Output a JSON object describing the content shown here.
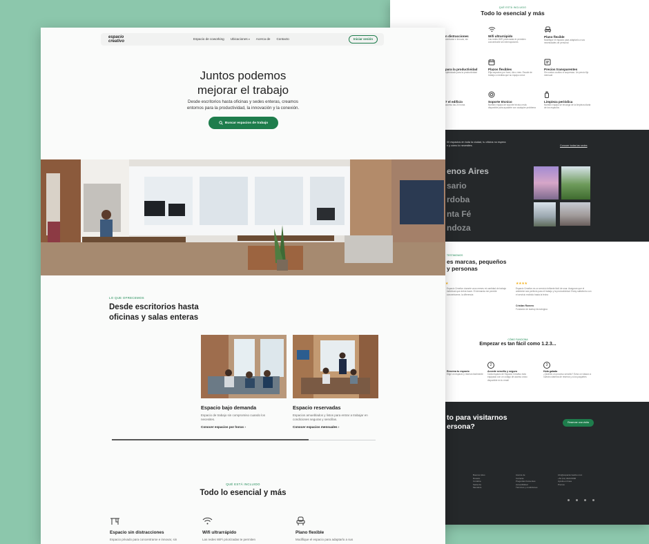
{
  "colors": {
    "background": "#8cc7ac",
    "accent": "#1e7d4c",
    "dark": "#25282a",
    "stars": "#f2b01e"
  },
  "front": {
    "header": {
      "logo": "espacio creativo",
      "nav": [
        "Espacio de coworking",
        "Ubicaciones",
        "Acerca de",
        "Contacto"
      ],
      "login": "Iniciar sesión"
    },
    "hero": {
      "title_line1": "Juntos podemos",
      "title_line2": "mejorar el trabajo",
      "subtitle_line1": "Desde escritorios hasta oficinas y sedes enteras, creamos",
      "subtitle_line2": "entornos para la productividad, la innovación y la conexión.",
      "cta": "Buscar espacios de trabajo"
    },
    "offer": {
      "eyebrow": "LO QUE OFRECEMOS",
      "title_line1": "Desde escritorios hasta",
      "title_line2": "oficinas y salas enteras",
      "cards": [
        {
          "title": "Espacio bajo demanda",
          "desc_line1": "Espacio de trabajo sin compromiso cuando los",
          "desc_line2": "necesites.",
          "link": "Conocer espacios por horas"
        },
        {
          "title": "Espacio reservadas",
          "desc_line1": "Espacios amueblados y listos para entrar a trabajar en",
          "desc_line2": "condiciones seguras y sencillas.",
          "link": "Conocer espacios mensuales"
        }
      ]
    },
    "included": {
      "eyebrow": "QUÉ ESTÁ INCLUIDO",
      "title": "Todo lo esencial y más",
      "features": [
        {
          "icon": "desk-icon",
          "title": "Espacio sin distracciones",
          "desc": "Espacio privado para concentrarse e innovar, sin"
        },
        {
          "icon": "wifi-icon",
          "title": "Wifi ultrarrápido",
          "desc": "Las redes WiFi priorizadas te permiten"
        },
        {
          "icon": "chair-icon",
          "title": "Plano flexible",
          "desc": "Modifique el espacio para adaptarlo a sus"
        }
      ]
    }
  },
  "back": {
    "included": {
      "eyebrow": "QUÉ ESTÁ INCLUIDO",
      "title": "Todo lo esencial y más",
      "features": [
        {
          "icon": "desk-icon",
          "title": "n distracciones",
          "desc": "centrarse e innovar, sin"
        },
        {
          "icon": "wifi-icon",
          "title": "Wifi ultrarrápido",
          "desc": "Las redes WiFi priorizadas te permiten concentrarte sin interrupciones"
        },
        {
          "icon": "chair-icon",
          "title": "Plano flexible",
          "desc": "Modifique el espacio para adaptarlo a sus necesidades de personal"
        },
        {
          "icon": "bulb-icon",
          "title": "para la productividad",
          "desc": "optimizado para la productividad"
        },
        {
          "icon": "calendar-icon",
          "title": "Plazos flexibles",
          "desc": "Elija espacios por hora, día o mes. Escale de trabajo a medida que su equipo crece"
        },
        {
          "icon": "price-icon",
          "title": "Precios transparentes",
          "desc": "Sin costos ocultos ni sorpresas. Un precio fijo mensual"
        },
        {
          "icon": "building-icon",
          "title": "7 el edificio",
          "desc": "acceso las 24 horas"
        },
        {
          "icon": "support-icon",
          "title": "Soporte técnico",
          "desc": "Nuestro equipo de soporte técnico está disponible para ayudarte con cualquier problema"
        },
        {
          "icon": "cleaning-icon",
          "title": "Limpieza periódica",
          "desc": "Nuestro equipo se encarga de la limpieza diaria de los espacios"
        }
      ]
    },
    "locations": {
      "intro_line1": "00 espacios en toda la ciudad, tu oficina no espera",
      "intro_line2": "n y cómo lo necesites.",
      "link": "Conocer todas las sedes",
      "cities": [
        "enos Aires",
        "sario",
        "rdoba",
        "nta Fé",
        "ndoza"
      ]
    },
    "testimonials": {
      "eyebrow": "TESTIMONIOS",
      "title_line1": "es marcas, pequeños",
      "title_line2": "y personas",
      "quote1": "Espacio Creativo durante unos meses mi cantidad de trabajo individual que debía hacer. El demanda me permite concentrarme, la diferencia",
      "quote2": "Espacio Creativo es un servicio brillante fácil de usar. Aseguran que el ambiente sea perfecto para el trabajo y la productividad. Estoy satisfecho con el servicio recibido hasta la fecha",
      "author2": "Cristian Romero",
      "role2": "Fundador de startup tecnológica"
    },
    "steps": {
      "eyebrow": "CÓMO FUNCIONA",
      "title": "Empezar es tan fácil como 1.2.3...",
      "items": [
        {
          "num": "1",
          "title": "Reserva tu espacio",
          "desc": "Elige un espacio y reserva fácilmente"
        },
        {
          "num": "2",
          "title": "Accede sencillo y seguro",
          "desc": "Cada espacio de Espacio Creativo está equipado con un código de acceso único disponible en tu email"
        },
        {
          "num": "3",
          "title": "Hola galada",
          "desc": "¿Quieres un proceso sencillo? Echa un vistazo a nuestro sistema de reserva y a los paquetes"
        }
      ]
    },
    "cta": {
      "title_line1": "to para visitarnos",
      "title_line2": "ersona?",
      "button": "Reservar una visita"
    },
    "footer": {
      "col1": [
        "Buenos Aires",
        "Rosario",
        "Córdoba",
        "Santa Fe",
        "Mendoza"
      ],
      "col2": [
        "Acerca de",
        "Carreras",
        "Preguntas frecuentes",
        "Accesibilidad",
        "Términos y condiciones"
      ],
      "col3": [
        "info@espaciocreativo.com",
        "+54 (11) 4323-5000",
        "Ayuda en línea",
        "Prensa"
      ]
    }
  }
}
